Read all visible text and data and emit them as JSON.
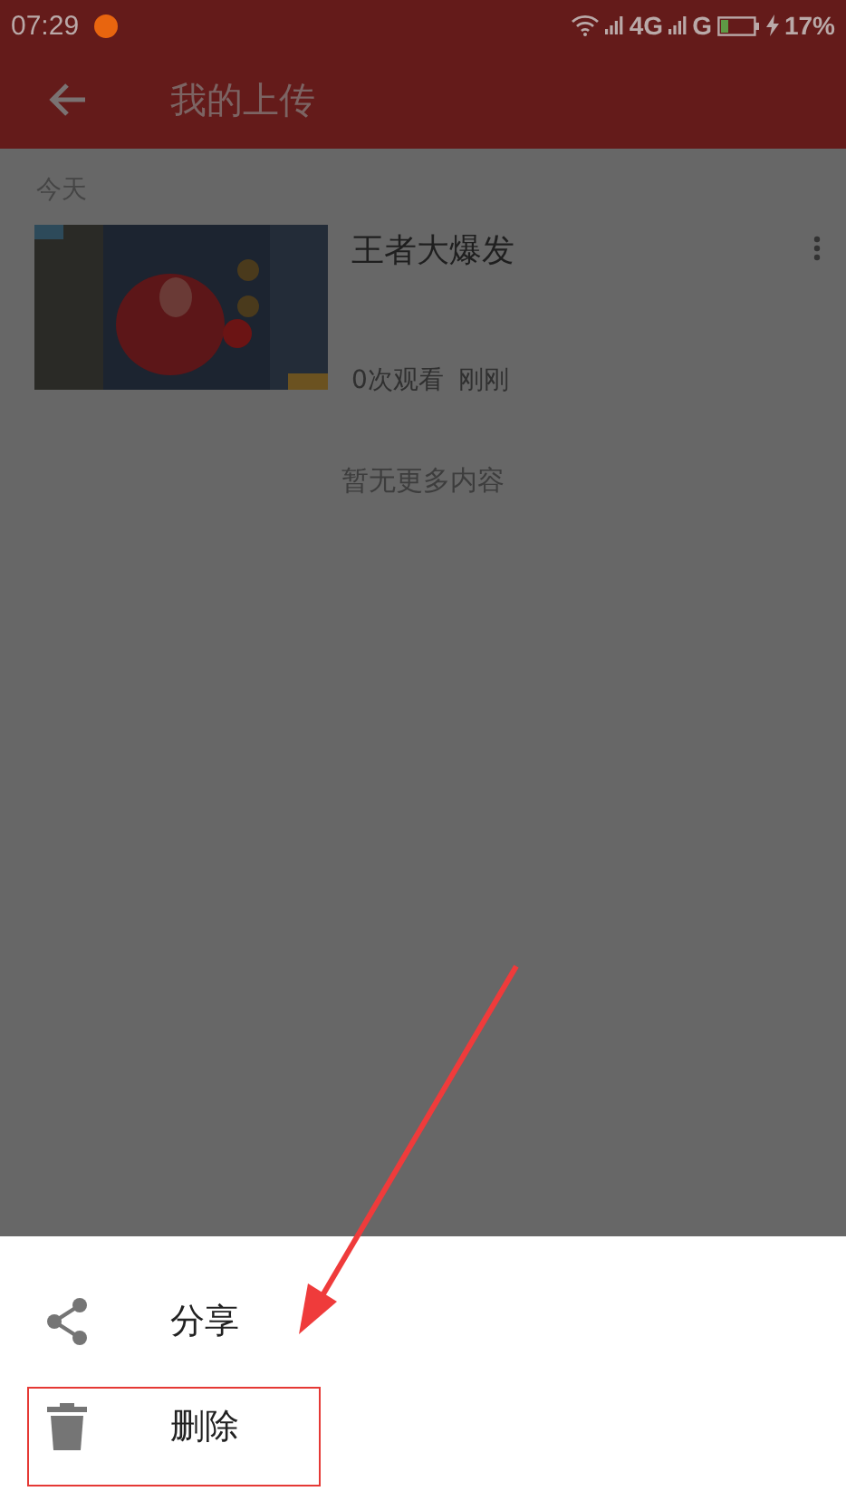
{
  "status_bar": {
    "time": "07:29",
    "network_labels": [
      "4G",
      "G"
    ],
    "battery": "17%"
  },
  "app_bar": {
    "title": "我的上传"
  },
  "sections": [
    {
      "header": "今天",
      "videos": [
        {
          "title": "王者大爆发",
          "views": "0次观看",
          "time": "刚刚"
        }
      ]
    }
  ],
  "end_note": "暂无更多内容",
  "sheet": {
    "items": [
      {
        "kind": "share",
        "label": "分享",
        "highlighted": false
      },
      {
        "kind": "delete",
        "label": "删除",
        "highlighted": true
      }
    ]
  }
}
